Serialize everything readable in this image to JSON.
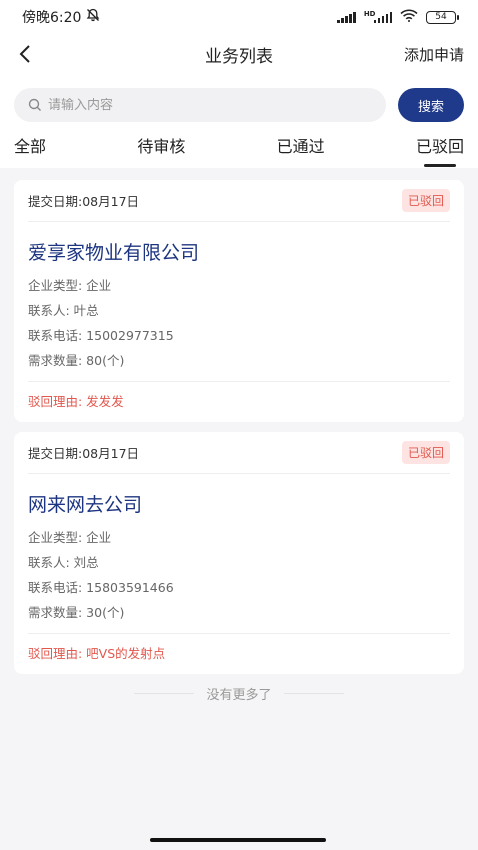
{
  "status_bar": {
    "time": "傍晚6:20",
    "network_label": "HD",
    "battery": "54"
  },
  "nav": {
    "title": "业务列表",
    "right_action": "添加申请"
  },
  "search": {
    "placeholder": "请输入内容",
    "value": "",
    "button_label": "搜索"
  },
  "tabs": [
    {
      "label": "全部",
      "active": false
    },
    {
      "label": "待审核",
      "active": false
    },
    {
      "label": "已通过",
      "active": false
    },
    {
      "label": "已驳回",
      "active": true
    }
  ],
  "cards": [
    {
      "date": "提交日期:08月17日",
      "badge": "已驳回",
      "company": "爱享家物业有限公司",
      "type": "企业类型:  企业",
      "contact": "联系人:  叶总",
      "phone": "联系电话:  15002977315",
      "quantity": "需求数量:  80(个)",
      "reason": "驳回理由:  发发发"
    },
    {
      "date": "提交日期:08月17日",
      "badge": "已驳回",
      "company": "网来网去公司",
      "type": "企业类型:  企业",
      "contact": "联系人:  刘总",
      "phone": "联系电话:  15803591466",
      "quantity": "需求数量:  30(个)",
      "reason": "驳回理由:  吧VS的发射点"
    }
  ],
  "footer": {
    "no_more": "没有更多了"
  },
  "colors": {
    "accent": "#1f3a8a",
    "reject": "#e2584e",
    "reject_bg": "#fde4e2",
    "company": "#1d3580"
  }
}
